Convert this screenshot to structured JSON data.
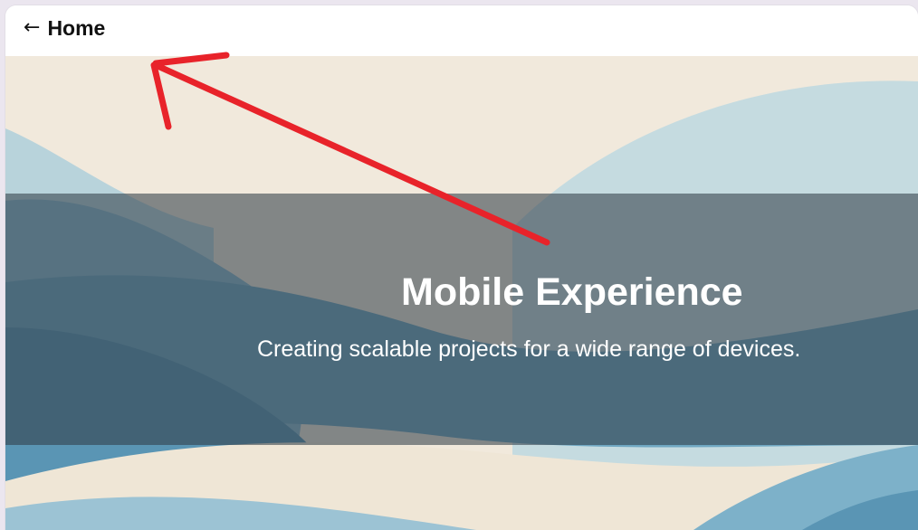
{
  "nav": {
    "back_arrow": "←",
    "back_label": "Home"
  },
  "hero": {
    "title": "Mobile Experience",
    "subtitle": "Creating scalable projects for a wide range of devices."
  },
  "colors": {
    "hero_background": "#f1e9dc",
    "wave_light": "#c5dbe0",
    "wave_mid": "#8ab9cf",
    "wave_dark": "#5a95b4",
    "annotation_red": "#e8232a"
  },
  "icons": {
    "back": "left-arrow-icon",
    "annotation": "hand-drawn-red-arrow"
  }
}
